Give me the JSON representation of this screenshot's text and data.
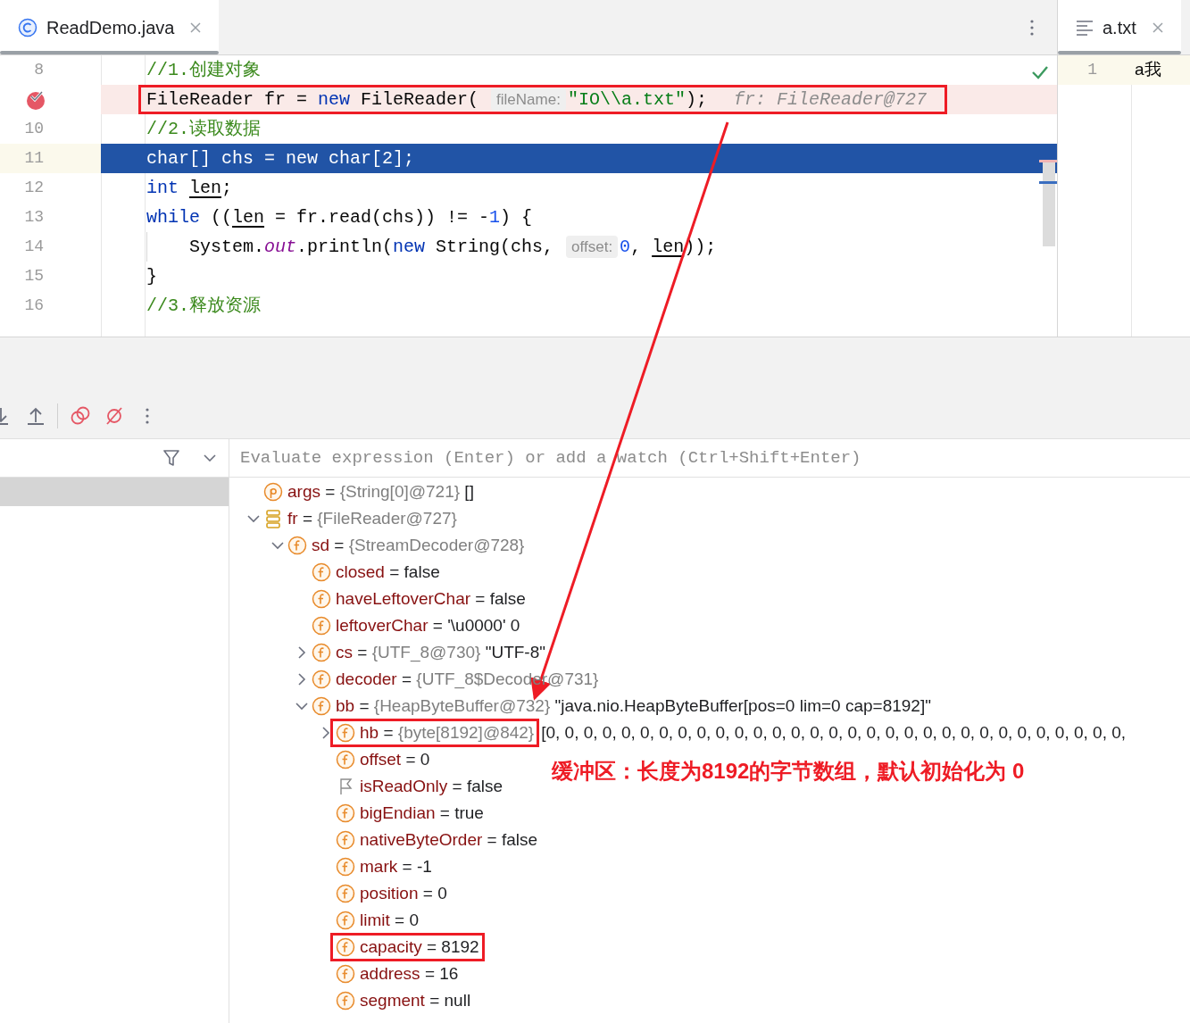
{
  "editor": {
    "tabs": [
      {
        "label": "ReadDemo.java",
        "selected": true
      }
    ],
    "lines": [
      {
        "number": "8",
        "tokens": [
          {
            "kind": "comment",
            "t": "//1.创建对象"
          }
        ]
      },
      {
        "breakpoint": true,
        "highlighted": true,
        "tokens": [
          {
            "kind": "plain",
            "t": "FileReader fr = "
          },
          {
            "kind": "kw",
            "t": "new"
          },
          {
            "kind": "plain",
            "t": " FileReader( "
          },
          {
            "kind": "hint",
            "t": "fileName:"
          },
          {
            "kind": "str",
            "t": "\"IO\\\\a.txt\""
          },
          {
            "kind": "plain",
            "t": ");"
          },
          {
            "kind": "inline",
            "t": "fr: FileReader@727"
          }
        ]
      },
      {
        "number": "10",
        "tokens": [
          {
            "kind": "comment",
            "t": "//2.读取数据"
          }
        ]
      },
      {
        "number": "11",
        "current": true,
        "tokens": [
          {
            "kind": "plain",
            "t": "char[] chs = new char[2];"
          }
        ]
      },
      {
        "number": "12",
        "tokens": [
          {
            "kind": "kw",
            "t": "int "
          },
          {
            "kind": "var",
            "t": "len"
          },
          {
            "kind": "plain",
            "t": ";"
          }
        ]
      },
      {
        "number": "13",
        "tokens": [
          {
            "kind": "kw",
            "t": "while"
          },
          {
            "kind": "plain",
            "t": " (("
          },
          {
            "kind": "var",
            "t": "len"
          },
          {
            "kind": "plain",
            "t": " = fr.read(chs)) != -"
          },
          {
            "kind": "num",
            "t": "1"
          },
          {
            "kind": "plain",
            "t": ") {"
          }
        ],
        "children": [
          {
            "number": "14",
            "tokens": [
              {
                "kind": "plain",
                "t": "System."
              },
              {
                "kind": "field",
                "t": "out"
              },
              {
                "kind": "plain",
                "t": ".println("
              },
              {
                "kind": "kw",
                "t": "new"
              },
              {
                "kind": "plain",
                "t": " String(chs, "
              },
              {
                "kind": "hint",
                "t": "offset:"
              },
              {
                "kind": "num",
                "t": "0"
              },
              {
                "kind": "plain",
                "t": ", "
              },
              {
                "kind": "var",
                "t": "len"
              },
              {
                "kind": "plain",
                "t": "));"
              }
            ]
          }
        ]
      },
      {
        "number": "15",
        "tokens": [
          {
            "kind": "plain",
            "t": "}"
          }
        ]
      },
      {
        "number": "16",
        "tokens": [
          {
            "kind": "comment",
            "t": "//3.释放资源"
          }
        ]
      }
    ]
  },
  "side_editor": {
    "tabs": [
      {
        "label": "a.txt",
        "selected": true
      }
    ],
    "lines": [
      {
        "number": "1",
        "text": "a我",
        "current": true
      }
    ]
  },
  "debugger": {
    "eval_placeholder": "Evaluate expression (Enter) or add a watch (Ctrl+Shift+Enter)",
    "variables": [
      {
        "kind": "parameter",
        "name": "args",
        "op": "=",
        "ref": "{String[0]@721}",
        "value": "[]"
      },
      {
        "kind": "object",
        "name": "fr",
        "op": "=",
        "ref": "{FileReader@727}",
        "expanded": true,
        "children": [
          {
            "kind": "field",
            "name": "sd",
            "op": "=",
            "ref": "{StreamDecoder@728}",
            "expanded": true,
            "children": [
              {
                "kind": "field",
                "name": "closed",
                "op": "=",
                "value": "false"
              },
              {
                "kind": "field",
                "name": "haveLeftoverChar",
                "op": "=",
                "value": "false"
              },
              {
                "kind": "field",
                "name": "leftoverChar",
                "op": "=",
                "value": "'\\u0000' 0"
              },
              {
                "kind": "field",
                "name": "cs",
                "op": "=",
                "ref": "{UTF_8@730}",
                "value": "\"UTF-8\"",
                "expanded": false
              },
              {
                "kind": "field",
                "name": "decoder",
                "op": "=",
                "ref": "{UTF_8$Decoder@731}",
                "expanded": false
              },
              {
                "kind": "field",
                "name": "bb",
                "op": "=",
                "ref": "{HeapByteBuffer@732}",
                "value": "\"java.nio.HeapByteBuffer[pos=0 lim=0 cap=8192]\"",
                "expanded": true,
                "children": [
                  {
                    "kind": "field",
                    "name": "hb",
                    "op": "=",
                    "ref": "{byte[8192]@842}",
                    "value": "[0, 0, 0, 0, 0, 0, 0, 0, 0, 0, 0, 0, 0, 0, 0, 0, 0, 0, 0, 0, 0, 0, 0, 0, 0, 0, 0, 0, 0, 0, 0,",
                    "expanded": false,
                    "highlighted": true
                  },
                  {
                    "kind": "field",
                    "name": "offset",
                    "op": "=",
                    "value": "0"
                  },
                  {
                    "kind": "flag",
                    "name": "isReadOnly",
                    "op": "=",
                    "value": "false"
                  },
                  {
                    "kind": "field",
                    "name": "bigEndian",
                    "op": "=",
                    "value": "true"
                  },
                  {
                    "kind": "field",
                    "name": "nativeByteOrder",
                    "op": "=",
                    "value": "false"
                  },
                  {
                    "kind": "field",
                    "name": "mark",
                    "op": "=",
                    "value": "-1"
                  },
                  {
                    "kind": "field",
                    "name": "position",
                    "op": "=",
                    "value": "0"
                  },
                  {
                    "kind": "field",
                    "name": "limit",
                    "op": "=",
                    "value": "0"
                  },
                  {
                    "kind": "field",
                    "name": "capacity",
                    "op": "=",
                    "value": "8192",
                    "highlighted": true
                  },
                  {
                    "kind": "field",
                    "name": "address",
                    "op": "=",
                    "value": "16"
                  },
                  {
                    "kind": "field",
                    "name": "segment",
                    "op": "=",
                    "value": "null"
                  }
                ]
              }
            ]
          }
        ]
      }
    ]
  },
  "annotation": "缓冲区：长度为8192的字节数组，默认初始化为 0"
}
